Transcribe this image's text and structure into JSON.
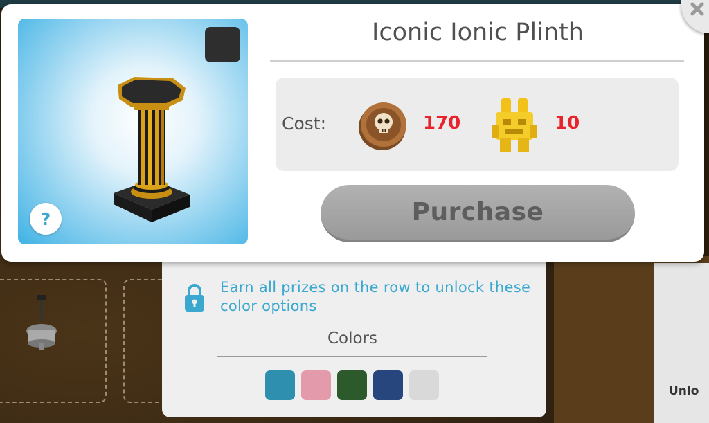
{
  "item": {
    "title": "Iconic Ionic Plinth",
    "selected_color": "#2e2e2e"
  },
  "cost": {
    "label": "Cost:",
    "currencies": [
      {
        "icon": "skull-coin-icon",
        "value": "170"
      },
      {
        "icon": "golden-tiki-icon",
        "value": "10"
      }
    ]
  },
  "purchase": {
    "label": "Purchase"
  },
  "help": {
    "label": "?"
  },
  "colors_panel": {
    "unlock_message": "Earn all prizes on the row to unlock these color options",
    "title": "Colors",
    "swatches": [
      "#2f8faf",
      "#e39aaa",
      "#2c5a2a",
      "#27467e",
      "#d9d9d9"
    ]
  },
  "background": {
    "unlock_label": "Unlo"
  },
  "colors": {
    "accent_blue": "#3aa8cf",
    "price_red": "#e8232a",
    "disabled_button": "#a6a6a6"
  }
}
